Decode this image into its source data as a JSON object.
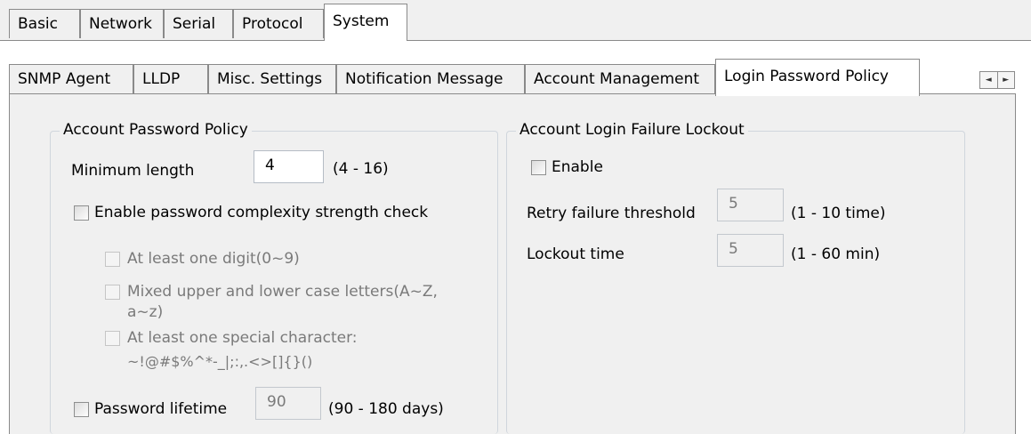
{
  "main_tabs": [
    "Basic",
    "Network",
    "Serial",
    "Protocol",
    "System"
  ],
  "sub_tabs": [
    "SNMP Agent",
    "LLDP",
    "Misc. Settings",
    "Notification Message",
    "Account Management",
    "Login Password Policy"
  ],
  "scroll_glyphs": {
    "left": "◄",
    "right": "►"
  },
  "password_policy": {
    "title": "Account Password Policy",
    "min_length_label": "Minimum length",
    "min_length_value": "4",
    "min_length_range": "(4 - 16)",
    "complexity_label": "Enable password complexity strength check",
    "digit_label": "At least one digit(0~9)",
    "case_label_1": "Mixed upper and lower case letters(A~Z,",
    "case_label_2": "a~z)",
    "special_label_1": "At least one special character:",
    "special_label_2": "~!@#$%^*-_|;:,.<>[]{}()",
    "lifetime_label": "Password lifetime",
    "lifetime_value": "90",
    "lifetime_range": "(90 - 180 days)"
  },
  "lockout": {
    "title": "Account Login Failure Lockout",
    "enable_label": "Enable",
    "retry_label": "Retry failure threshold",
    "retry_value": "5",
    "retry_range": "(1 - 10 time)",
    "lockout_label": "Lockout time",
    "lockout_value": "5",
    "lockout_range": "(1 - 60 min)"
  }
}
